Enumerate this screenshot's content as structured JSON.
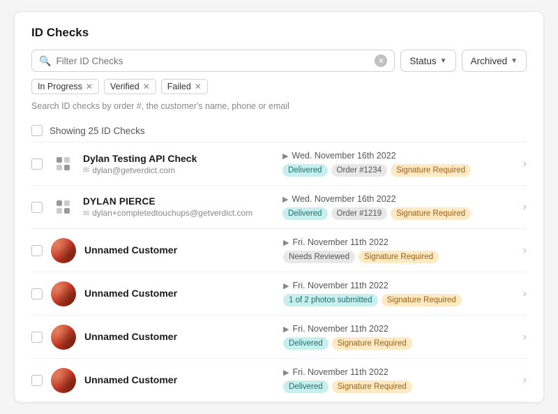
{
  "page": {
    "title": "ID Checks",
    "search": {
      "placeholder": "Filter ID Checks",
      "hint": "Search ID checks by order #, the customer's name, phone or email"
    },
    "filters": {
      "status_label": "Status",
      "archived_label": "Archived",
      "active_tags": [
        {
          "label": "In Progress"
        },
        {
          "label": "Verified"
        },
        {
          "label": "Failed"
        }
      ]
    },
    "showing_label": "Showing 25 ID Checks",
    "rows": [
      {
        "id": 1,
        "name": "Dylan Testing API Check",
        "name_style": "normal",
        "email": "dylan@getverdict.com",
        "date": "Wed. November 16th 2022",
        "avatar_type": "api",
        "badges": [
          {
            "type": "delivered",
            "text": "Delivered"
          },
          {
            "type": "order",
            "text": "Order #1234"
          },
          {
            "type": "signature",
            "text": "Signature Required"
          }
        ]
      },
      {
        "id": 2,
        "name": "DYLAN PIERCE",
        "name_style": "uppercase",
        "email": "dylan+completedtouchups@getverdict.com",
        "date": "Wed. November 16th 2022",
        "avatar_type": "api",
        "badges": [
          {
            "type": "delivered",
            "text": "Delivered"
          },
          {
            "type": "order",
            "text": "Order #1219"
          },
          {
            "type": "signature",
            "text": "Signature Required"
          }
        ]
      },
      {
        "id": 3,
        "name": "Unnamed Customer",
        "name_style": "normal",
        "email": "",
        "date": "Fri. November 11th 2022",
        "avatar_type": "image",
        "badges": [
          {
            "type": "needs-reviewed",
            "text": "Needs Reviewed"
          },
          {
            "type": "signature",
            "text": "Signature Required"
          }
        ]
      },
      {
        "id": 4,
        "name": "Unnamed Customer",
        "name_style": "normal",
        "email": "",
        "date": "Fri. November 11th 2022",
        "avatar_type": "image",
        "badges": [
          {
            "type": "photos",
            "text": "1 of 2 photos submitted"
          },
          {
            "type": "signature",
            "text": "Signature Required"
          }
        ]
      },
      {
        "id": 5,
        "name": "Unnamed Customer",
        "name_style": "normal",
        "email": "",
        "date": "Fri. November 11th 2022",
        "avatar_type": "image",
        "badges": [
          {
            "type": "delivered",
            "text": "Delivered"
          },
          {
            "type": "signature",
            "text": "Signature Required"
          }
        ]
      },
      {
        "id": 6,
        "name": "Unnamed Customer",
        "name_style": "normal",
        "email": "",
        "date": "Fri. November 11th 2022",
        "avatar_type": "image",
        "badges": [
          {
            "type": "delivered",
            "text": "Delivered"
          },
          {
            "type": "signature",
            "text": "Signature Required"
          }
        ]
      }
    ]
  }
}
